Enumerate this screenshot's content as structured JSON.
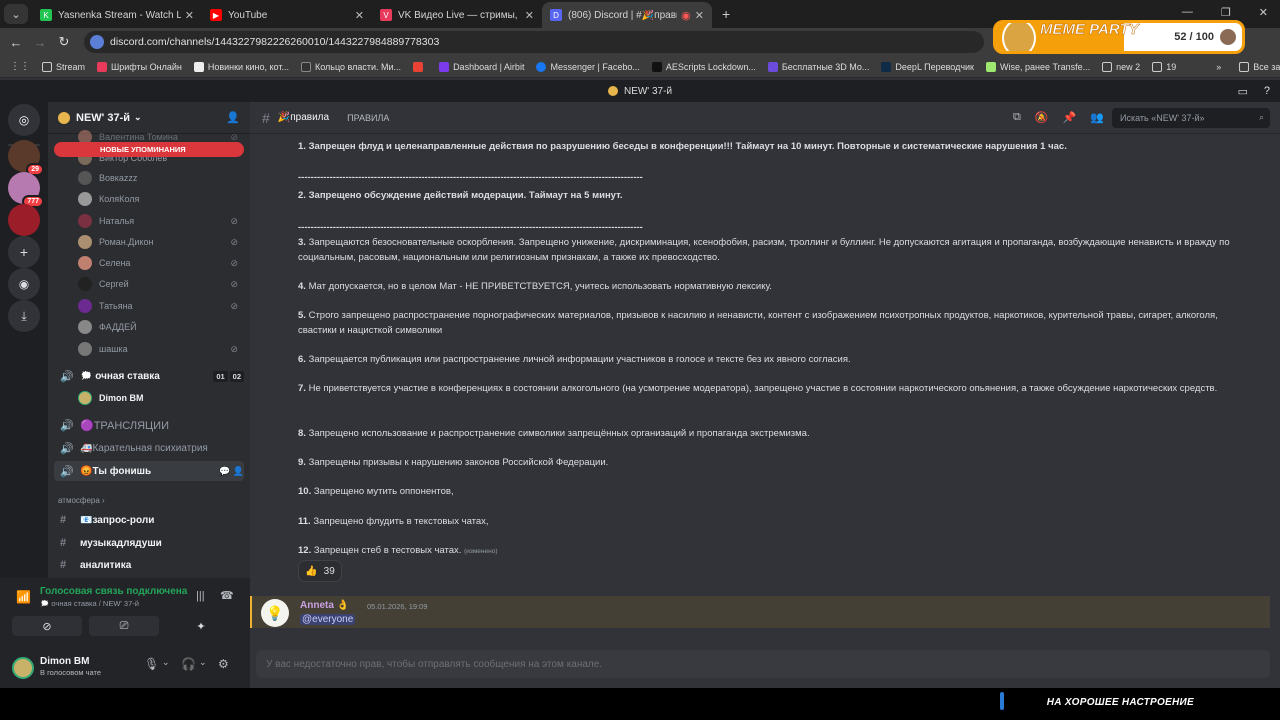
{
  "browser": {
    "tabs": [
      {
        "label": "Yasnenka Stream - Watch Live o",
        "color": "#23c552",
        "glyph": "K"
      },
      {
        "label": "YouTube",
        "color": "#ff0000",
        "glyph": "▶"
      },
      {
        "label": "VK Видео Live — стримы, пря",
        "color": "#e83a5b",
        "glyph": "V"
      },
      {
        "label": "(806) Discord | #🎉правил",
        "color": "#5865f2",
        "glyph": "D"
      }
    ],
    "url": "discord.com/channels/1443227982226260010/1443227984889778303",
    "bookmarks": [
      "Stream",
      "Шрифты Онлайн",
      "Новинки кино, кот...",
      "Кольцо власти. Ми...",
      "",
      "Dashboard | Airbit",
      "Messenger | Facebo...",
      "AEScripts Lockdown...",
      "Бесплатные 3D Мо...",
      "DeepL Переводчик",
      "Wise, ранее Transfe...",
      "new 2",
      "19",
      "Все закладки"
    ]
  },
  "overlay": {
    "title": "MEME PARTY",
    "count": "52 / 100",
    "progress": 0.52,
    "mood": "НА ХОРОШЕЕ НАСТРОЕНИЕ"
  },
  "discord_title": "NEW' 37-й",
  "server": {
    "name": "NEW' 37-й",
    "badges": [
      "29",
      "777"
    ]
  },
  "sidebar": {
    "new_mentions": "НОВЫЕ УПОМИНАНИЯ",
    "voice_users": [
      {
        "name": "Валентина Томина",
        "color": "#b97a6a",
        "muted": true
      },
      {
        "name": "Виктор Соболев",
        "color": "#7a6a5a",
        "muted": false
      },
      {
        "name": "Вовкаzzz",
        "color": "#555",
        "muted": false
      },
      {
        "name": "КоляКоля",
        "color": "#999",
        "muted": false
      },
      {
        "name": "Наталья",
        "color": "#7a3040",
        "muted": true
      },
      {
        "name": "Роман.Дикон",
        "color": "#aa9070",
        "muted": true
      },
      {
        "name": "Селена",
        "color": "#c08070",
        "muted": true
      },
      {
        "name": "Сергей",
        "color": "#222",
        "muted": true
      },
      {
        "name": "Татьяна",
        "color": "#6a2a90",
        "muted": true
      },
      {
        "name": "ФАДДЕЙ",
        "color": "#888",
        "muted": false
      },
      {
        "name": "шашка",
        "color": "#777",
        "muted": true
      }
    ],
    "voice_channel": {
      "name": "🗯️ очная ставка",
      "counts": [
        "01",
        "02"
      ],
      "user": "Dimon BM"
    },
    "channels": [
      {
        "name": "🟣ТРАНСЛЯЦИИ",
        "icon": "🔊"
      },
      {
        "name": "🚑Карательная психиатрия",
        "icon": "🔊"
      },
      {
        "name": "😡Ты фонишь",
        "icon": "🔊"
      }
    ],
    "category": "атмосфера",
    "text_channels": [
      "📧запрос-роли",
      "музыкадлядуши",
      "аналитика"
    ]
  },
  "voice": {
    "status": "Голосовая связь подключена",
    "sub": "🗯️ очная ставка / NEW' 37-й"
  },
  "user": {
    "name": "Dimon BM",
    "status": "В голосовом чате"
  },
  "channel": {
    "name": "🎉правила",
    "topic": "ПРАВИЛА",
    "search_placeholder": "Искать «NEW' 37-й»"
  },
  "rules": [
    {
      "n": "1.",
      "text": "Запрещен флуд и целенаправленные действия по разрушению беседы в конференции!!! Таймаут на 10 минут. Повторные и систематические нарушения 1 час.",
      "bold": true
    },
    {
      "n": "2.",
      "text": "Запрещено обсуждение действий модерации. Таймаут на 5 минут.",
      "bold": true
    },
    {
      "n": "3.",
      "text": "Запрещаются безосновательные оскорбления. Запрещено унижение, дискриминация, ксенофобия, расизм, троллинг и буллинг. Не допускаются агитация и пропаганда, возбуждающие ненависть и вражду по социальным, расовым, национальным или религиозным признакам, а также их превосходство.",
      "bold": false
    },
    {
      "n": "4.",
      "text": "Мат допускается, но в целом  Мат - НЕ ПРИВЕТСТВУЕТСЯ, учитесь использовать  нормативную лексику.",
      "bold": false
    },
    {
      "n": "5.",
      "text": "Строго запрещено распространение порнографических материалов, призывов к насилию и ненависти, контент с изображением психотропных продуктов, наркотиков, курительной травы, сигарет, алкоголя, свастики и  нацисткой символики",
      "bold": false
    },
    {
      "n": "6.",
      "text": "Запрещается публикация или распространение личной информации участников в голосе и тексте без их явного согласия.",
      "bold": false
    },
    {
      "n": "7.",
      "text": "Не приветствуется участие в конференциях в состоянии алкогольного (на усмотрение модератора), запрещено участие в состоянии наркотического опьянения, а также обсуждение наркотических средств.",
      "bold": false
    },
    {
      "n": "8.",
      "text": "Запрещено использование и распространение символики запрещённых организаций и пропаганда экстремизма.",
      "bold": false
    },
    {
      "n": "9.",
      "text": "Запрещены призывы к нарушению законов Российской Федерации.",
      "bold": false
    },
    {
      "n": "10.",
      "text": "Запрещено мутить оппонентов,",
      "bold": false
    },
    {
      "n": "11.",
      "text": "Запрещено флудить в текстовых чатах,",
      "bold": false
    },
    {
      "n": "12.",
      "text": "Запрещен стеб в тестовых чатах.",
      "bold": false
    }
  ],
  "separator": "-------------------------------------------------------------------------------------------------------------",
  "edited_label": "(изменено)",
  "reaction": {
    "emoji": "👍",
    "count": "39"
  },
  "message": {
    "author": "Anneta",
    "author_emoji": "👌",
    "timestamp": "05.01.2026, 19:09",
    "mention": "@everyone"
  },
  "composer": {
    "placeholder": "У вас недостаточно прав, чтобы отправлять сообщения на этом канале."
  },
  "colors": {
    "accent": "#5865f2",
    "mention_bg": "#444035",
    "online": "#23a55a",
    "danger": "#da373c"
  }
}
